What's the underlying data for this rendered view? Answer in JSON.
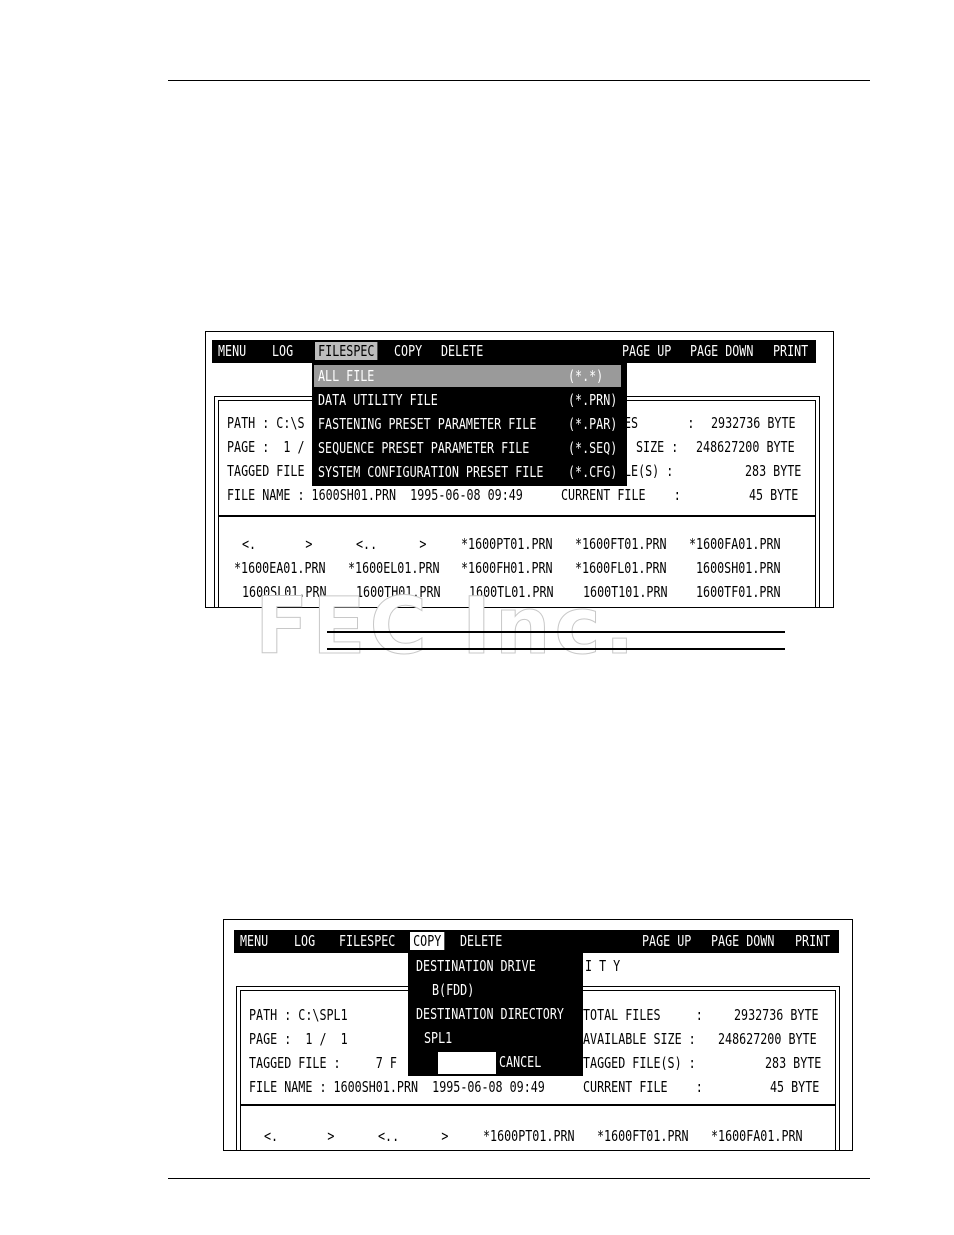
{
  "screen1": {
    "menu": {
      "items": [
        "MENU",
        "LOG",
        "FILESPEC",
        "COPY",
        "DELETE"
      ],
      "right_items": [
        "PAGE UP",
        "PAGE DOWN",
        "PRINT"
      ]
    },
    "dropdown": [
      {
        "label": "ALL FILE",
        "ext": "(*.*)"
      },
      {
        "label": "DATA UTILITY FILE",
        "ext": "(*.PRN)"
      },
      {
        "label": "FASTENING PRESET PARAMETER FILE",
        "ext": "(*.PAR)"
      },
      {
        "label": "SEQUENCE PRESET PARAMETER FILE",
        "ext": "(*.SEQ)"
      },
      {
        "label": "SYSTEM CONFIGURATION PRESET FILE",
        "ext": "(*.CFG)"
      }
    ],
    "info_left": [
      "PATH : C:\\S",
      "PAGE :  1 /",
      "TAGGED FILE",
      "FILE NAME : 1600SH01.PRN  1995-06-08 09:49"
    ],
    "info_right": [
      {
        "label": "ES       :",
        "value": "2932736 BYTE"
      },
      {
        "label": "SIZE :",
        "value": "248627200 BYTE"
      },
      {
        "label": "LE(S) :",
        "value": "283 BYTE"
      },
      {
        "label": "CURRENT FILE    :",
        "value": "45 BYTE"
      }
    ],
    "files": [
      [
        "<.       >",
        "<..      >",
        "*1600PT01.PRN",
        "*1600FT01.PRN",
        "*1600FA01.PRN"
      ],
      [
        "*1600EA01.PRN",
        "*1600EL01.PRN",
        "*1600FH01.PRN",
        "*1600FL01.PRN",
        "1600SH01.PRN"
      ],
      [
        "1600SL01.PRN",
        "1600TH01.PRN",
        "1600TL01.PRN",
        "1600T101.PRN",
        "1600TF01.PRN"
      ]
    ]
  },
  "watermark": "FEC Inc.",
  "screen2": {
    "menu": {
      "items": [
        "MENU",
        "LOG",
        "FILESPEC",
        "COPY",
        "DELETE"
      ],
      "right_items": [
        "PAGE UP",
        "PAGE DOWN",
        "PRINT"
      ]
    },
    "title_fragment": "I T Y",
    "dialog": {
      "drive_label": "DESTINATION DRIVE",
      "drive_value": "B(FDD)",
      "dir_label": "DESTINATION DIRECTORY",
      "dir_value": "SPL1",
      "cancel_label": "CANCEL"
    },
    "info_left": [
      "PATH : C:\\SPL1",
      "PAGE :  1 /  1",
      "TAGGED FILE :     7 F",
      "FILE NAME : 1600SH01.PRN  1995-06-08 09:49"
    ],
    "info_right": [
      {
        "label": "TOTAL FILES     :",
        "value": "2932736 BYTE"
      },
      {
        "label": "AVAILABLE SIZE :",
        "value": "248627200 BYTE"
      },
      {
        "label": "TAGGED FILE(S) :",
        "value": "283 BYTE"
      },
      {
        "label": "CURRENT FILE    :",
        "value": "45 BYTE"
      }
    ],
    "files": [
      [
        "<.       >",
        "<..      >",
        "*1600PT01.PRN",
        "*1600FT01.PRN",
        "*1600FA01.PRN"
      ]
    ]
  }
}
